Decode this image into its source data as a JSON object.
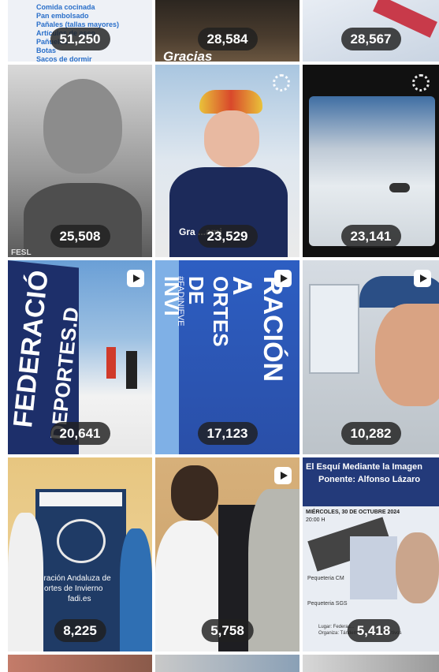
{
  "tiles": [
    {
      "count": "51,250",
      "lines": [
        "Comida cocinada",
        "Pan embolsado",
        "Pañales (tallas mayores)",
        "Artículos de aseo",
        "Pañuelos",
        "Botas",
        "Sacos de dormir"
      ]
    },
    {
      "count": "28,584",
      "caption": "Gracias"
    },
    {
      "count": "28,567"
    },
    {
      "count": "25,508",
      "text": "FESL"
    },
    {
      "count": "23,529",
      "text": "Gra   ...amj"
    },
    {
      "count": "23,141"
    },
    {
      "count": "20,641",
      "banner": "FEDERACIÓ",
      "banner2": "DEPORTES.D"
    },
    {
      "count": "17,123",
      "banner": "RACIÓN A",
      "banner2": "ORTES DE INVI",
      "hashtag": "#FADINIEVE"
    },
    {
      "count": "10,282"
    },
    {
      "count": "8,225",
      "text1": "eración Andaluza de",
      "text2": "ortes de Invierno",
      "text3": "fadi.es"
    },
    {
      "count": "5,758"
    },
    {
      "count": "5,418",
      "poster_title": "El Esquí Mediante la Imagen",
      "poster_speaker": "Ponente: Alfonso Lázaro",
      "poster_date": "MIÉRCOLES, 30 DE OCTUBRE 2024",
      "poster_time": "20:00 H",
      "poster_label1": "Pequeteria CM",
      "poster_label2": "Pequeteria SGS",
      "poster_footer1": "Lugar: Federac...",
      "poster_footer2": "Organiza: Tándem Técnicos Deportivos"
    }
  ]
}
